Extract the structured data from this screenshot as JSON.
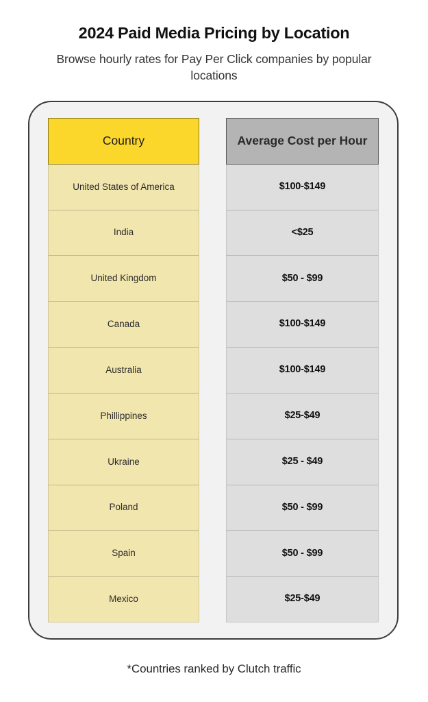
{
  "header": {
    "title": "2024 Paid Media Pricing by Location",
    "subtitle": "Browse hourly rates for Pay Per Click companies by popular locations"
  },
  "table": {
    "columns": [
      {
        "key": "country",
        "label": "Country",
        "header_bg": "#FCD72B",
        "body_bg": "#F2E6AF"
      },
      {
        "key": "cost",
        "label": "Average Cost per Hour",
        "header_bg": "#B4B4B4",
        "body_bg": "#DEDEDE"
      }
    ],
    "rows": [
      {
        "country": "United States of America",
        "cost": "$100-$149"
      },
      {
        "country": "India",
        "cost": "<$25"
      },
      {
        "country": "United Kingdom",
        "cost": "$50 - $99"
      },
      {
        "country": "Canada",
        "cost": "$100-$149"
      },
      {
        "country": "Australia",
        "cost": "$100-$149"
      },
      {
        "country": "Phillippines",
        "cost": "$25-$49"
      },
      {
        "country": "Ukraine",
        "cost": "$25 - $49"
      },
      {
        "country": "Poland",
        "cost": "$50 - $99"
      },
      {
        "country": "Spain",
        "cost": "$50 - $99"
      },
      {
        "country": "Mexico",
        "cost": "$25-$49"
      }
    ]
  },
  "footnote": "*Countries ranked by Clutch traffic",
  "colors": {
    "page_background": "#FFFFFF",
    "card_background": "#F2F2F2",
    "card_border": "#3C3C3C",
    "accent_yellow": "#FCD72B",
    "accent_yellow_light": "#F2E6AF",
    "accent_gray": "#B4B4B4",
    "accent_gray_light": "#DEDEDE",
    "text": "#1A1A1A"
  },
  "chart_data": {
    "type": "table",
    "title": "2024 Paid Media Pricing by Location",
    "subtitle": "Browse hourly rates for Pay Per Click companies by popular locations",
    "columns": [
      "Country",
      "Average Cost per Hour"
    ],
    "rows": [
      [
        "United States of America",
        "$100-$149"
      ],
      [
        "India",
        "<$25"
      ],
      [
        "United Kingdom",
        "$50 - $99"
      ],
      [
        "Canada",
        "$100-$149"
      ],
      [
        "Australia",
        "$100-$149"
      ],
      [
        "Phillippines",
        "$25-$49"
      ],
      [
        "Ukraine",
        "$25 - $49"
      ],
      [
        "Poland",
        "$50 - $99"
      ],
      [
        "Spain",
        "$50 - $99"
      ],
      [
        "Mexico",
        "$25-$49"
      ]
    ],
    "annotations": [
      "*Countries ranked by Clutch traffic"
    ]
  }
}
